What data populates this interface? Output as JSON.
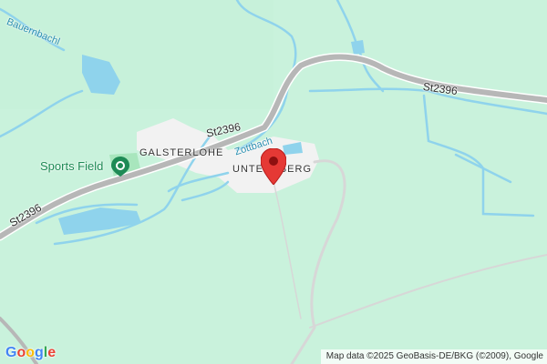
{
  "map": {
    "labels": {
      "stream_top": "Bauernbachl",
      "village_1": "GALSTERLOHE",
      "village_2": "UNTERNBERG",
      "stream_mid": "Zottbach",
      "road_a": "St2396",
      "road_b": "St2396",
      "road_c": "St2396"
    },
    "poi": {
      "name": "Sports Field",
      "icon": "park-pin-icon"
    },
    "marker": {
      "icon": "location-pin-icon",
      "color": "#e53935"
    },
    "attribution": "Map data ©2025 GeoBasis-DE/BKG (©2009), Google",
    "logo": [
      "G",
      "o",
      "o",
      "g",
      "l",
      "e"
    ],
    "colors": {
      "land": "#c9f2dc",
      "water": "#8fd3ec",
      "road": "#b7b7b7",
      "built": "#f2f2f2",
      "poi_green": "#1e8a55"
    }
  }
}
